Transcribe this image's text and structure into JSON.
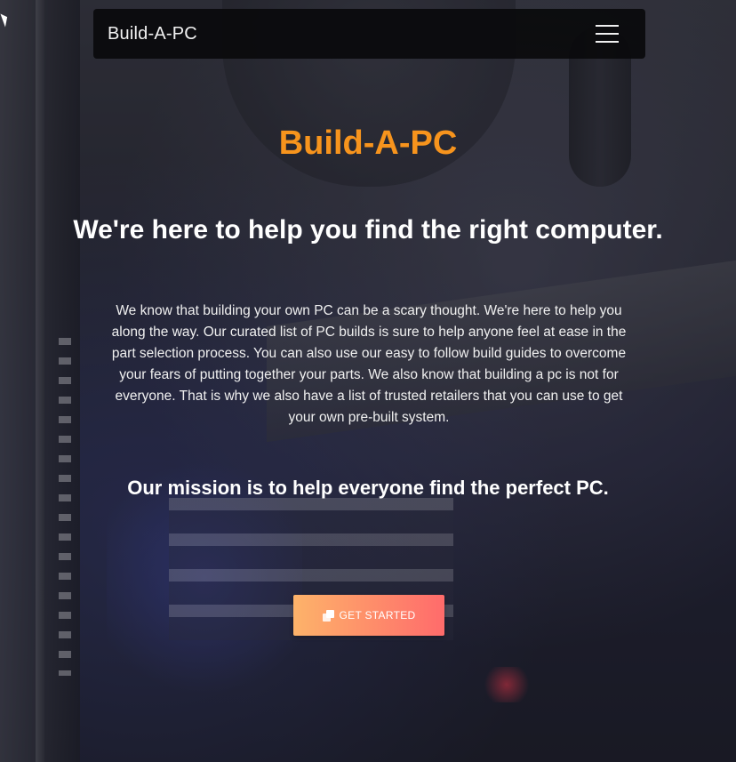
{
  "navbar": {
    "brand": "Build-A-PC",
    "menu_icon": "hamburger-menu-icon"
  },
  "hero": {
    "title": "Build-A-PC",
    "tagline": "We're here to help you find the right computer.",
    "intro": "We know that building your own PC can be a scary thought. We're here to help you along the way. Our curated list of PC builds is sure to help anyone feel at ease in the part selection process. You can also use our easy to follow build guides to overcome your fears of putting together your parts. We also know that building a pc is not for everyone. That is why we also have a list of trusted retailers that you can use to get your own pre-built system.",
    "mission": "Our mission is to help everyone find the perfect PC.",
    "cta_label": "GET STARTED",
    "cta_icon": "copy-stack-icon"
  },
  "colors": {
    "accent": "#f7941d",
    "navbar_bg": "#0a0a0c",
    "cta_gradient_start": "#fdb36a",
    "cta_gradient_end": "#ff6b6b"
  }
}
